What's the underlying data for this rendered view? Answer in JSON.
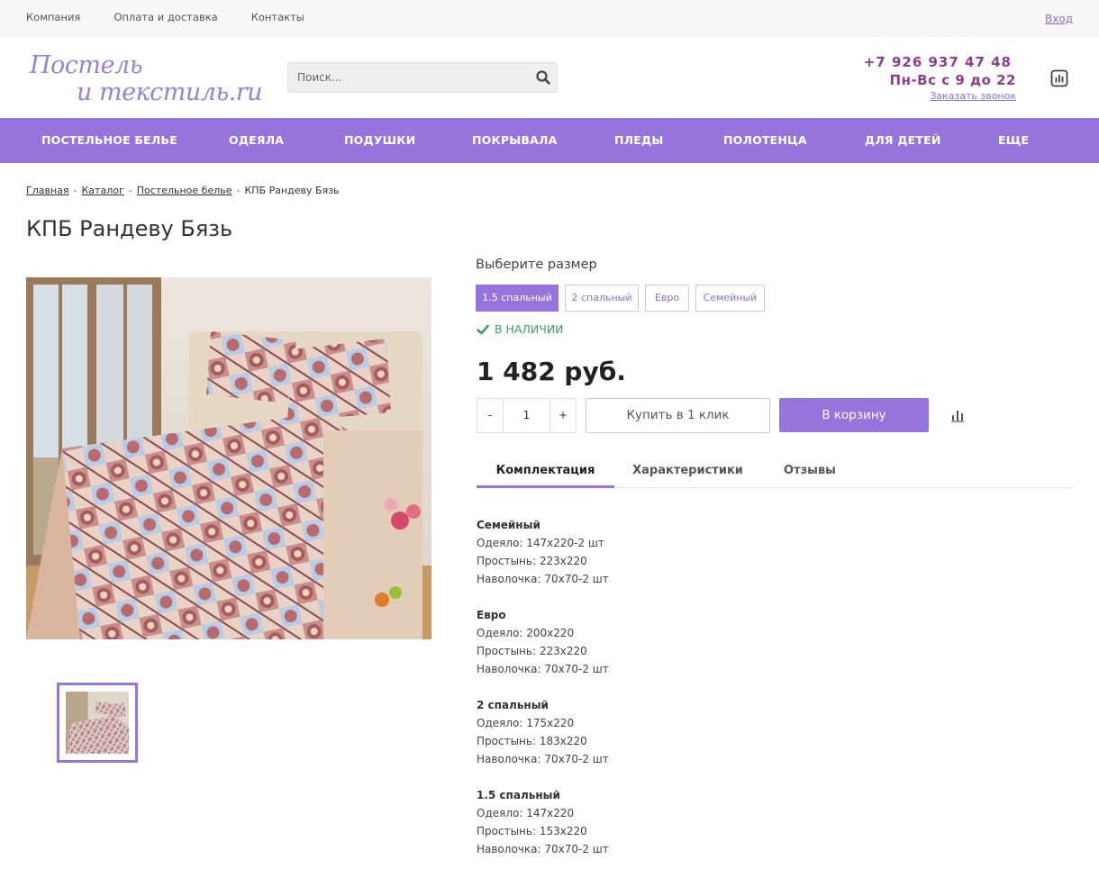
{
  "topbar": {
    "links": [
      "Компания",
      "Оплата и доставка",
      "Контакты"
    ],
    "login": "Вход"
  },
  "logo": {
    "line1": "Постель",
    "line2": "и текстиль.ru"
  },
  "search": {
    "placeholder": "Поиск..."
  },
  "contacts": {
    "phone": "+7 926 937 47 48",
    "hours": "Пн-Вс с 9 до 22",
    "callback": "Заказать звонок"
  },
  "nav": {
    "items": [
      "ПОСТЕЛЬНОЕ БЕЛЬЕ",
      "ОДЕЯЛА",
      "ПОДУШКИ",
      "ПОКРЫВАЛА",
      "ПЛЕДЫ",
      "ПОЛОТЕНЦА",
      "ДЛЯ ДЕТЕЙ",
      "ЕЩЕ"
    ]
  },
  "breadcrumb": {
    "items": [
      "Главная",
      "Каталог",
      "Постельное белье"
    ],
    "current": "КПБ Рандеву Бязь",
    "separator": "-"
  },
  "product": {
    "title": "КПБ Рандеву Бязь",
    "size_label": "Выберите размер",
    "sizes": [
      "1.5 спальный",
      "2 спальный",
      "Евро",
      "Семейный"
    ],
    "selected_size": "1.5 спальный",
    "stock": "В НАЛИЧИИ",
    "price": "1 482 руб.",
    "quantity": "1",
    "qty_minus": "-",
    "qty_plus": "+",
    "one_click": "Купить в 1 клик",
    "to_cart": "В корзину"
  },
  "tabs": {
    "items": [
      "Комплектация",
      "Характеристики",
      "Отзывы"
    ],
    "active": "Комплектация"
  },
  "spec": [
    {
      "title": "Семейный",
      "lines": [
        "Одеяло: 147x220-2 шт",
        "Простынь: 223x220",
        "Наволочка: 70x70-2 шт"
      ]
    },
    {
      "title": "Евро",
      "lines": [
        "Одеяло: 200x220",
        "Простынь: 223x220",
        "Наволочка: 70x70-2 шт"
      ]
    },
    {
      "title": "2 спальный",
      "lines": [
        "Одеяло: 175x220",
        "Простынь: 183x220",
        "Наволочка: 70x70-2 шт"
      ]
    },
    {
      "title": "1.5 спальный",
      "lines": [
        "Одеяло: 147x220",
        "Простынь: 153x220",
        "Наволочка: 70x70-2 шт"
      ]
    }
  ],
  "colors": {
    "accent": "#9575dc",
    "phone": "#8e3b94",
    "stock": "#3aa35b",
    "link": "#8e6fd2"
  },
  "icons": {
    "search": "search-icon",
    "compare": "bar-chart-icon",
    "stock": "check-icon"
  }
}
